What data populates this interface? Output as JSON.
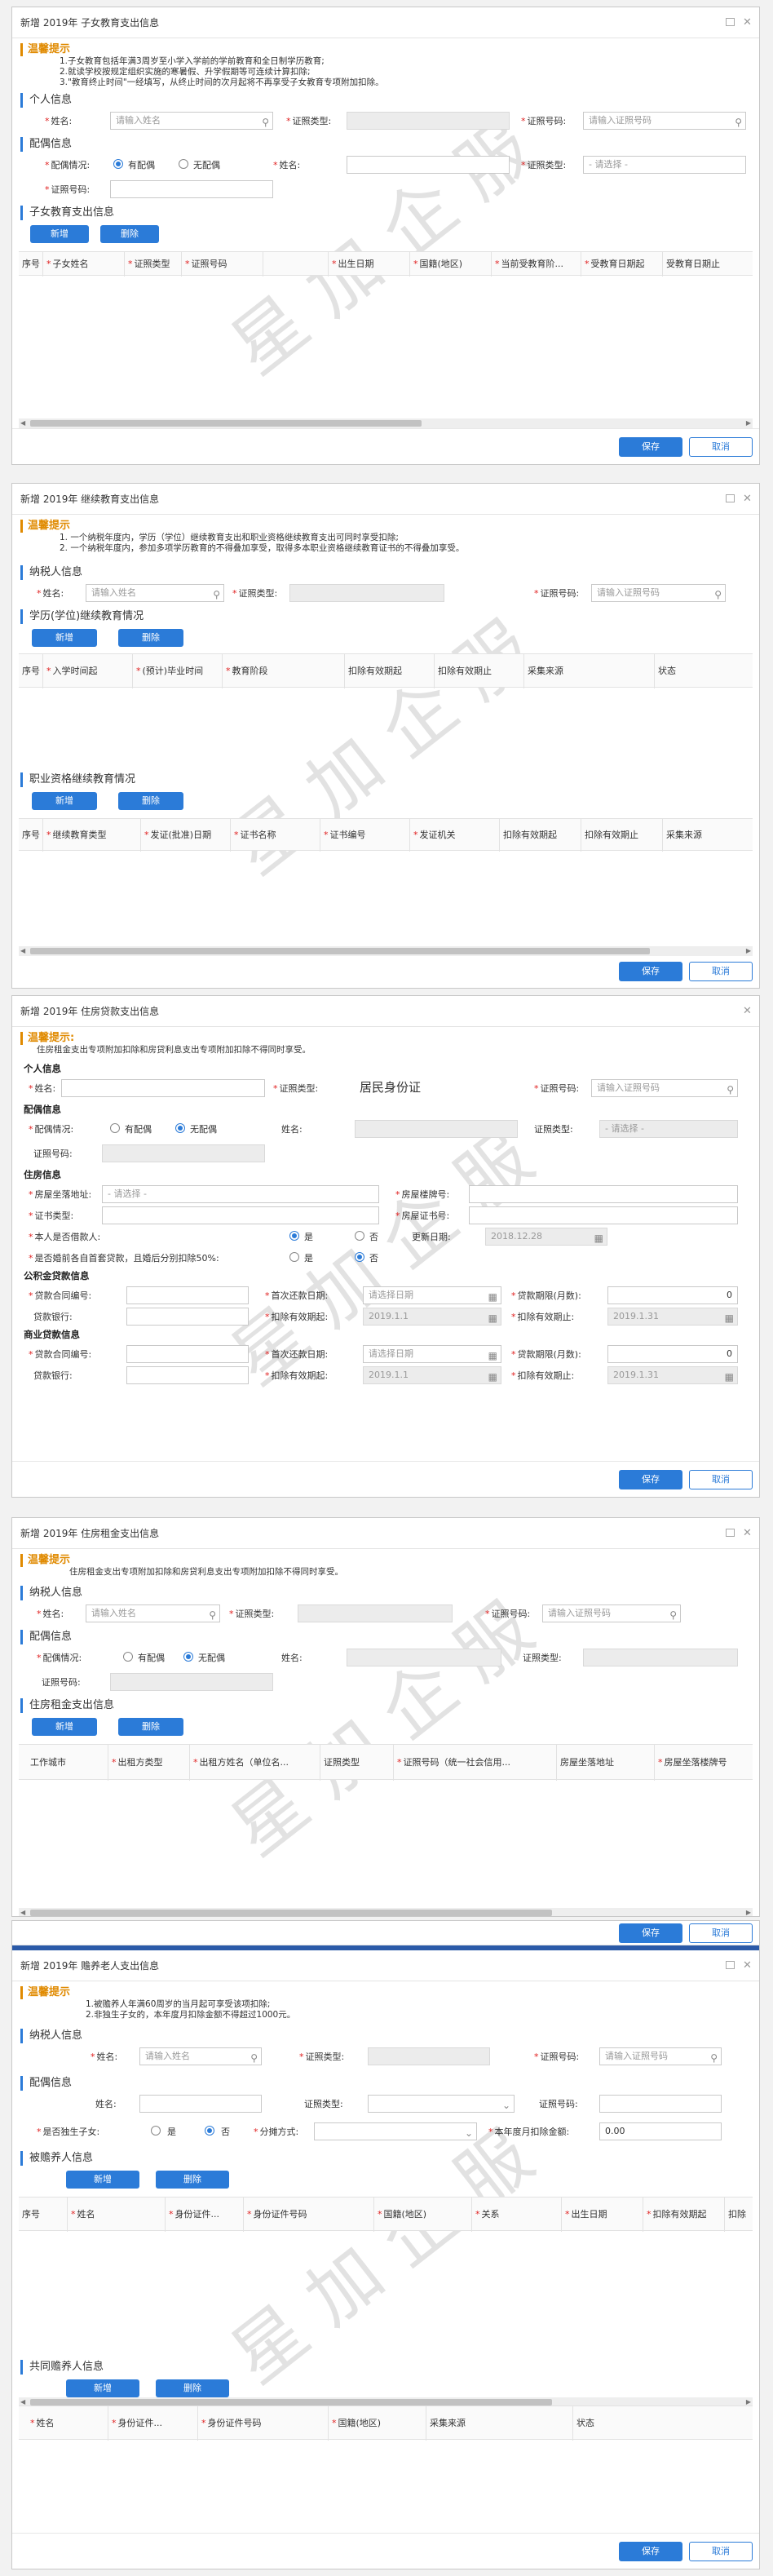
{
  "d1": {
    "title": "新增 2019年 子女教育支出信息",
    "tip_h": "温馨提示",
    "tips": [
      "1.子女教育包括年满3周岁至小学入学前的学前教育和全日制学历教育;",
      "2.就读学校按规定组织实施的寒暑假、升学假期等可连续计算扣除;",
      "3.\"教育终止时间\"一经填写，从终止时间的次月起将不再享受子女教育专项附加扣除。"
    ],
    "sec_personal": "个人信息",
    "name_lbl": "姓名:",
    "name_ph": "请输入姓名",
    "idtype_lbl": "证照类型:",
    "idno_lbl": "证照号码:",
    "idno_ph": "请输入证照号码",
    "sec_spouse": "配偶信息",
    "spouse_lbl": "配偶情况:",
    "has_spouse": "有配偶",
    "no_spouse": "无配偶",
    "sp_name_lbl": "姓名:",
    "sp_idtype_lbl": "证照类型:",
    "sp_idtype_ph": "- 请选择 -",
    "sp_idno_lbl": "证照号码:",
    "sec_child": "子女教育支出信息",
    "add": "新增",
    "del": "删除",
    "cols": [
      "序号",
      "子女姓名",
      "证照类型",
      "证照号码",
      "",
      "出生日期",
      "国籍(地区)",
      "当前受教育阶...",
      "受教育日期起",
      "受教育日期止"
    ],
    "save": "保存",
    "cancel": "取消"
  },
  "d2": {
    "title": "新增 2019年 继续教育支出信息",
    "tip_h": "温馨提示",
    "tips": [
      "1. 一个纳税年度内，学历（学位）继续教育支出和职业资格继续教育支出可同时享受扣除;",
      "2. 一个纳税年度内，参加多项学历教育的不得叠加享受，取得多本职业资格继续教育证书的不得叠加享受。"
    ],
    "sec_tax": "纳税人信息",
    "name_lbl": "姓名:",
    "name_ph": "请输入姓名",
    "idtype_lbl": "证照类型:",
    "idno_lbl": "证照号码:",
    "idno_ph": "请输入证照号码",
    "sec_degree": "学历(学位)继续教育情况",
    "add": "新增",
    "del": "删除",
    "cols1": [
      "序号",
      "入学时间起",
      "(预计)毕业时间",
      "教育阶段",
      "扣除有效期起",
      "扣除有效期止",
      "采集来源",
      "状态"
    ],
    "sec_prof": "职业资格继续教育情况",
    "cols2": [
      "序号",
      "继续教育类型",
      "发证(批准)日期",
      "证书名称",
      "证书编号",
      "发证机关",
      "扣除有效期起",
      "扣除有效期止",
      "采集来源"
    ],
    "save": "保存",
    "cancel": "取消"
  },
  "d3": {
    "title": "新增 2019年 住房贷款支出信息",
    "tip_h": "温馨提示:",
    "tips": [
      "住房租金支出专项附加扣除和房贷利息支出专项附加扣除不得同时享受。"
    ],
    "sec_personal": "个人信息",
    "name_lbl": "姓名:",
    "idtype_lbl": "证照类型:",
    "idtype_val": "居民身份证",
    "idno_lbl": "证照号码:",
    "idno_ph": "请输入证照号码",
    "sec_spouse": "配偶信息",
    "spouse_lbl": "配偶情况:",
    "has_spouse": "有配偶",
    "no_spouse": "无配偶",
    "sp_name_lbl": "姓名:",
    "sp_idtype_lbl": "证照类型:",
    "sp_idtype_ph": "- 请选择 -",
    "sp_idno_lbl": "证照号码:",
    "sec_house": "住房信息",
    "addr_lbl": "房屋坐落地址:",
    "addr_ph": "- 请选择 -",
    "cert_type_lbl": "房屋楼牌号:",
    "cert_lbl": "证书类型:",
    "cert_no_lbl": "房屋证书号:",
    "borrower_lbl": "本人是否借款人:",
    "yes": "是",
    "no": "否",
    "update_lbl": "更新日期:",
    "update_val": "2018.12.28",
    "marriage_lbl": "是否婚前各自首套贷款，且婚后分别扣除50%:",
    "sec_fund": "公积金贷款信息",
    "loan_no_lbl": "贷款合同编号:",
    "first_pay_lbl": "首次还款日期:",
    "first_pay_ph": "请选择日期",
    "months_lbl": "贷款期限(月数):",
    "months_val": "0",
    "bank_lbl": "贷款银行:",
    "ded_start_lbl": "扣除有效期起:",
    "ded_start_val": "2019.1.1",
    "ded_end_lbl": "扣除有效期止:",
    "ded_end_val": "2019.1.31",
    "sec_comm": "商业贷款信息",
    "save": "保存",
    "cancel": "取消"
  },
  "d4": {
    "title": "新增 2019年 住房租金支出信息",
    "tip_h": "温馨提示",
    "tips": [
      "住房租金支出专项附加扣除和房贷利息支出专项附加扣除不得同时享受。"
    ],
    "sec_tax": "纳税人信息",
    "name_lbl": "姓名:",
    "name_ph": "请输入姓名",
    "idtype_lbl": "证照类型:",
    "idno_lbl": "证照号码:",
    "idno_ph": "请输入证照号码",
    "sec_spouse": "配偶信息",
    "spouse_lbl": "配偶情况:",
    "has_spouse": "有配偶",
    "no_spouse": "无配偶",
    "sp_name_lbl": "姓名:",
    "sp_idtype_lbl": "证照类型:",
    "sp_idno_lbl": "证照号码:",
    "sec_rent": "住房租金支出信息",
    "add": "新增",
    "del": "删除",
    "cols": [
      "工作城市",
      "出租方类型",
      "出租方姓名（单位名...",
      "证照类型",
      "证照号码（统一社会信用...",
      "房屋坐落地址",
      "房屋坐落楼牌号"
    ],
    "save": "保存",
    "cancel": "取消"
  },
  "d5": {
    "title": "新增 2019年 赡养老人支出信息",
    "tip_h": "温馨提示",
    "tips": [
      "1.被赡养人年满60周岁的当月起可享受该项扣除;",
      "2.非独生子女的，本年度月扣除金额不得超过1000元。"
    ],
    "sec_tax": "纳税人信息",
    "name_lbl": "姓名:",
    "name_ph": "请输入姓名",
    "idtype_lbl": "证照类型:",
    "idno_lbl": "证照号码:",
    "idno_ph": "请输入证照号码",
    "sec_spouse": "配偶信息",
    "sp_name_lbl": "姓名:",
    "sp_idtype_lbl": "证照类型:",
    "sp_idno_lbl": "证照号码:",
    "only_child_lbl": "是否独生子女:",
    "yes": "是",
    "no": "否",
    "split_lbl": "分摊方式:",
    "amount_lbl": "本年度月扣除金额:",
    "amount_val": "0.00",
    "sec_elder": "被赡养人信息",
    "add": "新增",
    "del": "删除",
    "cols1": [
      "序号",
      "姓名",
      "身份证件...",
      "身份证件号码",
      "国籍(地区)",
      "关系",
      "出生日期",
      "扣除有效期起",
      "扣除"
    ],
    "sec_co": "共同赡养人信息",
    "cols2": [
      "姓名",
      "身份证件...",
      "身份证件号码",
      "国籍(地区)",
      "采集来源",
      "状态"
    ],
    "save": "保存",
    "cancel": "取消"
  },
  "watermark": "星加企服"
}
